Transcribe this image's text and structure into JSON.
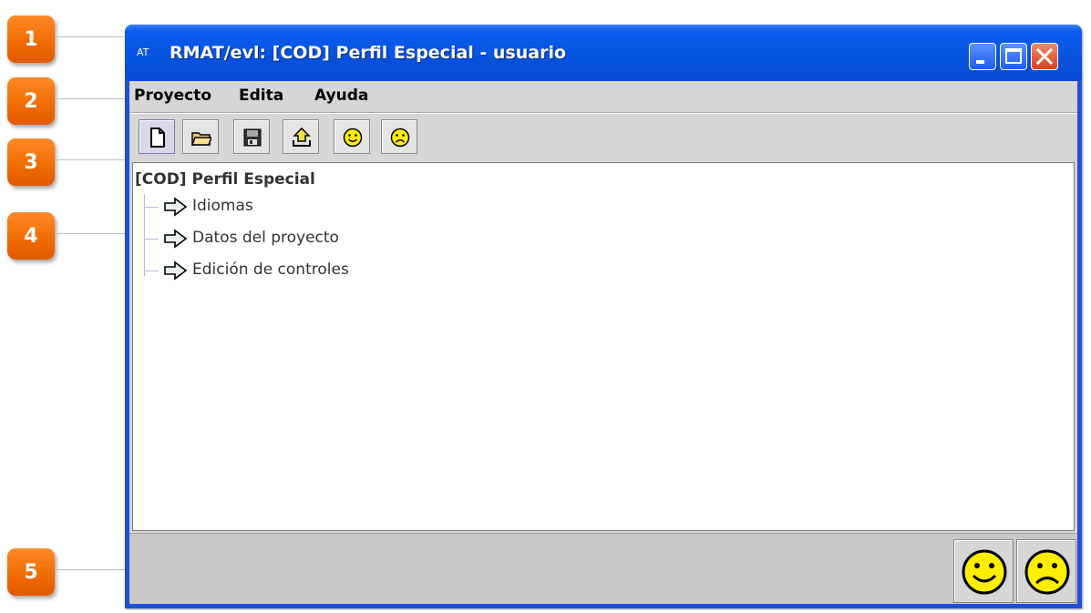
{
  "callouts": [
    {
      "number": "1"
    },
    {
      "number": "2"
    },
    {
      "number": "3"
    },
    {
      "number": "4"
    },
    {
      "number": "5"
    }
  ],
  "window": {
    "app_glyph": "AT",
    "title": "RMAT/evl: [COD] Perfil Especial - usuario"
  },
  "menubar": {
    "items": [
      {
        "label": "Proyecto"
      },
      {
        "label": "Edita"
      },
      {
        "label": "Ayuda"
      }
    ]
  },
  "toolbar": {
    "buttons": [
      {
        "icon": "new-document-icon"
      },
      {
        "icon": "open-folder-icon"
      },
      {
        "icon": "save-disk-icon"
      },
      {
        "icon": "upload-icon"
      },
      {
        "icon": "happy-face-icon"
      },
      {
        "icon": "sad-face-icon"
      }
    ]
  },
  "tree": {
    "root": "[COD] Perfil Especial",
    "nodes": [
      {
        "label": "Idiomas"
      },
      {
        "label": "Datos del proyecto"
      },
      {
        "label": "Edición de controles"
      }
    ]
  },
  "statusbar": {
    "buttons": [
      {
        "icon": "happy-face-icon"
      },
      {
        "icon": "sad-face-icon"
      }
    ]
  },
  "colors": {
    "callout_orange": "#f06a00",
    "titlebar_blue": "#0652dd",
    "panel_gray": "#d6d6d6",
    "smiley_yellow": "#ffee00"
  }
}
